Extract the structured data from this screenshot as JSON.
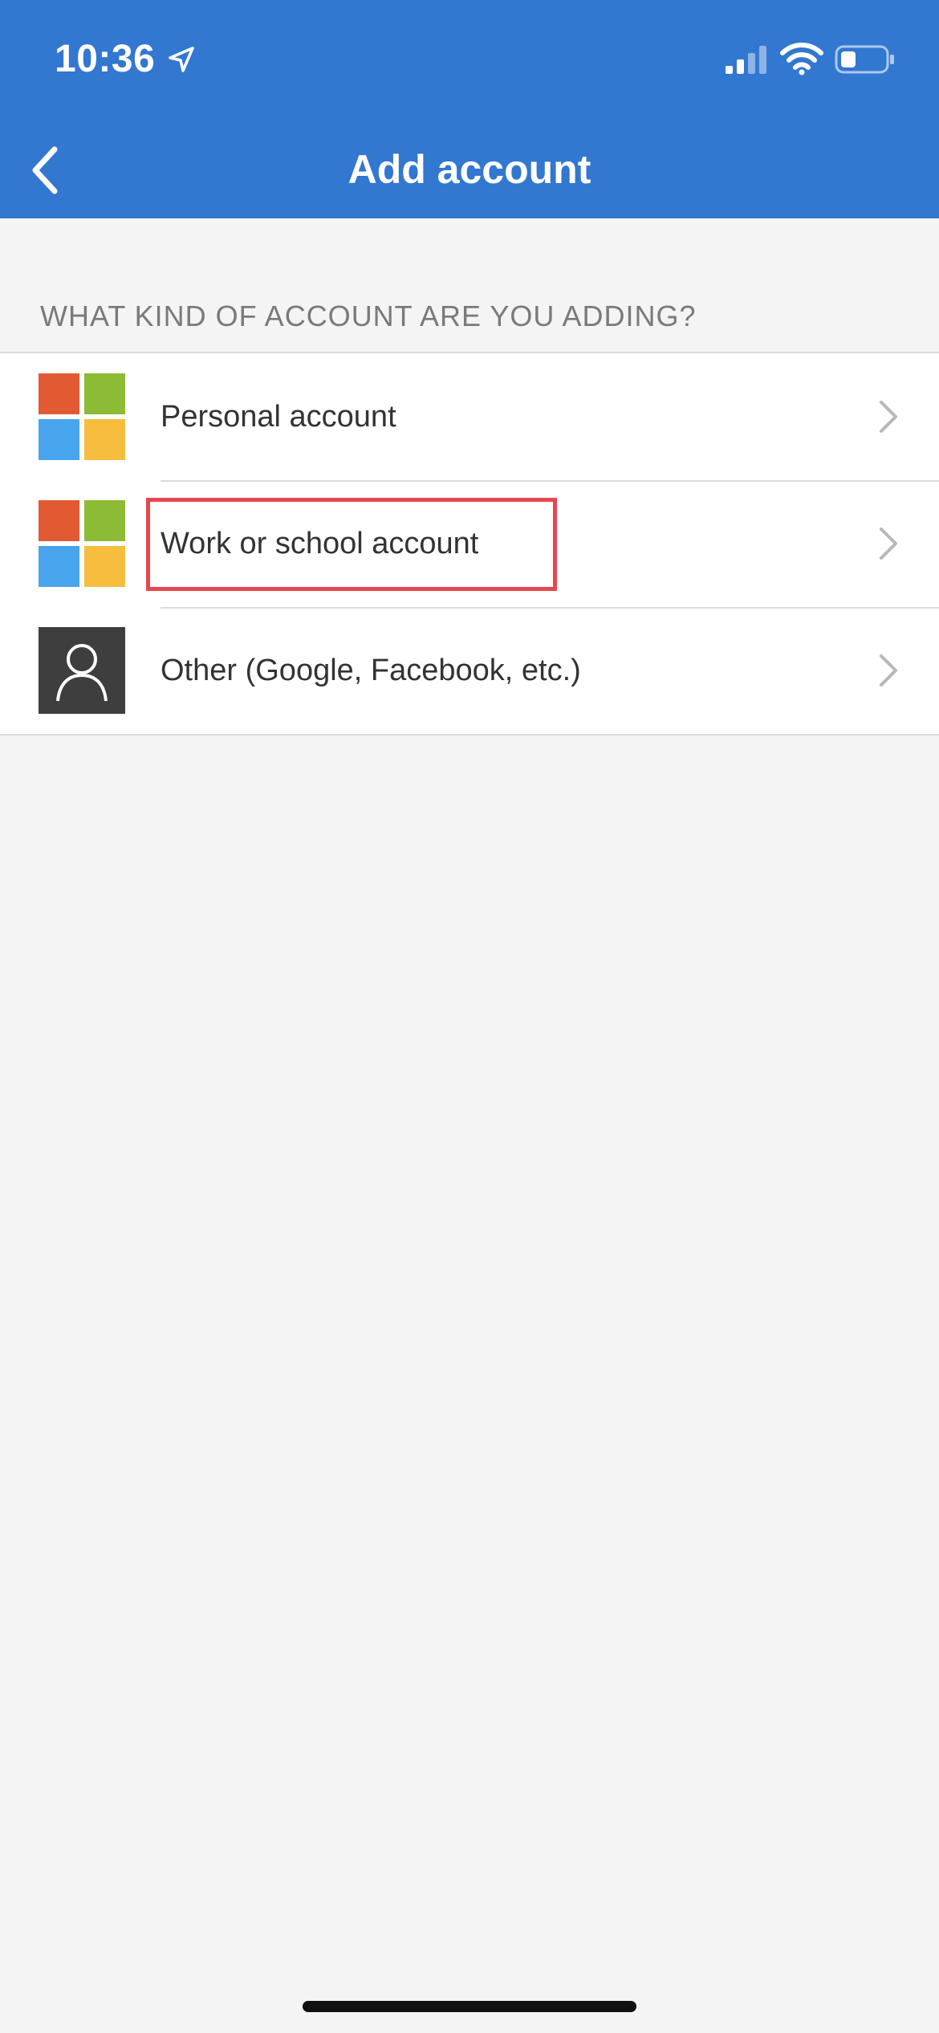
{
  "status_bar": {
    "time": "10:36"
  },
  "nav": {
    "title": "Add account"
  },
  "section": {
    "header": "WHAT KIND OF ACCOUNT ARE YOU ADDING?"
  },
  "accounts": [
    {
      "label": "Personal account",
      "icon": "microsoft-logo-icon"
    },
    {
      "label": "Work or school account",
      "icon": "microsoft-logo-icon"
    },
    {
      "label": "Other (Google, Facebook, etc.)",
      "icon": "person-icon"
    }
  ],
  "colors": {
    "header_bg": "#3277d0",
    "highlight": "#e8474f",
    "ms_red": "#e25a33",
    "ms_green": "#8cbb35",
    "ms_blue": "#48a4ec",
    "ms_yellow": "#f6bd3e"
  }
}
